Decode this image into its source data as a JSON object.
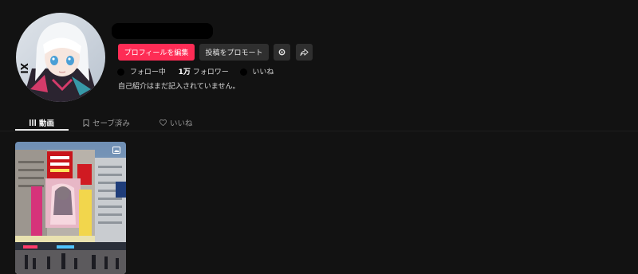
{
  "profile": {
    "edit_profile_label": "プロフィールを編集",
    "promote_label": "投稿をプロモート",
    "following_label": "フォロー中",
    "followers_count": "1万",
    "followers_label": "フォロワー",
    "likes_label": "いいね",
    "bio": "自己紹介はまだ記入されていません。"
  },
  "tabs": [
    {
      "label": "動画",
      "icon": "grid-icon",
      "active": true
    },
    {
      "label": "セーブ済み",
      "icon": "bookmark-icon",
      "active": false
    },
    {
      "label": "いいね",
      "icon": "heart-outline-icon",
      "active": false
    }
  ],
  "video": {
    "media_icon": "image-icon"
  },
  "colors": {
    "background": "#121212",
    "primary": "#fe2c55",
    "button_dark": "#2f2f2f"
  }
}
